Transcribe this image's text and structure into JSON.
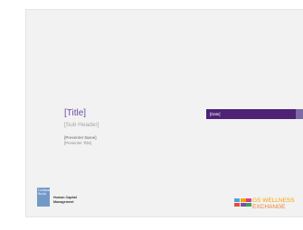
{
  "slide": {
    "title": "[Title]",
    "sub_header": "[Sub Header]",
    "presenter_name": "[Presenter Name]",
    "presenter_title": "[Presenter Title]",
    "date": "[Date]"
  },
  "branding": {
    "gs_logo_line1": "Goldman",
    "gs_logo_line2": "Sachs",
    "hcm_line1": "Human Capital",
    "hcm_line2": "Management",
    "wellness_line1": "GS WELLNESS",
    "wellness_line2": "EXCHANGE",
    "gs_logo_icon": "goldman-sachs-logo",
    "wellness_icon": "colored-tiles-logo"
  },
  "colors": {
    "title": "#6b4ba6",
    "date_bar": "#4e2376",
    "date_tab": "#7b6aa6",
    "gs_logo": "#7399c6",
    "wellness_line1": "#f5a300",
    "wellness_line2": "#f47e2a"
  }
}
